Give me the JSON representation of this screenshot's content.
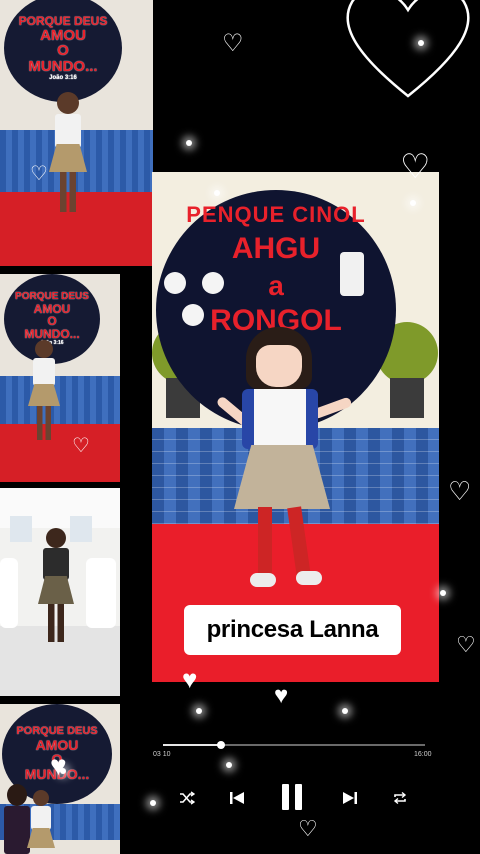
{
  "thumbnails": [
    {
      "sign_lines": [
        "PORQUE DEUS",
        "AMOU",
        "O",
        "MUNDO..."
      ],
      "verse": "João 3:16"
    },
    {
      "sign_lines": [
        "PORQUE DEUS",
        "AMOU",
        "O",
        "MUNDO..."
      ],
      "verse": "João 3:16"
    },
    {
      "sign_lines": [],
      "verse": ""
    },
    {
      "sign_lines": [
        "PORQUE DEUS",
        "AMOU",
        "O",
        "MUNDO..."
      ],
      "verse": ""
    }
  ],
  "main_image": {
    "sign_lines": [
      "PENQUE CINOL",
      "AHGU",
      "a",
      "RONGOL"
    ],
    "caption": "princesa Lanna"
  },
  "player": {
    "time_start": "03 10",
    "time_end": "16:00",
    "progress": 0.22,
    "controls": [
      "shuffle-icon",
      "previous-icon",
      "pause-icon",
      "next-icon",
      "repeat-icon"
    ]
  },
  "colors": {
    "background": "#000000",
    "stage_red": "#ea1e2a",
    "sign_navy": "#0f1430",
    "sign_text": "#e8212b",
    "caption_bg": "#ffffff"
  }
}
